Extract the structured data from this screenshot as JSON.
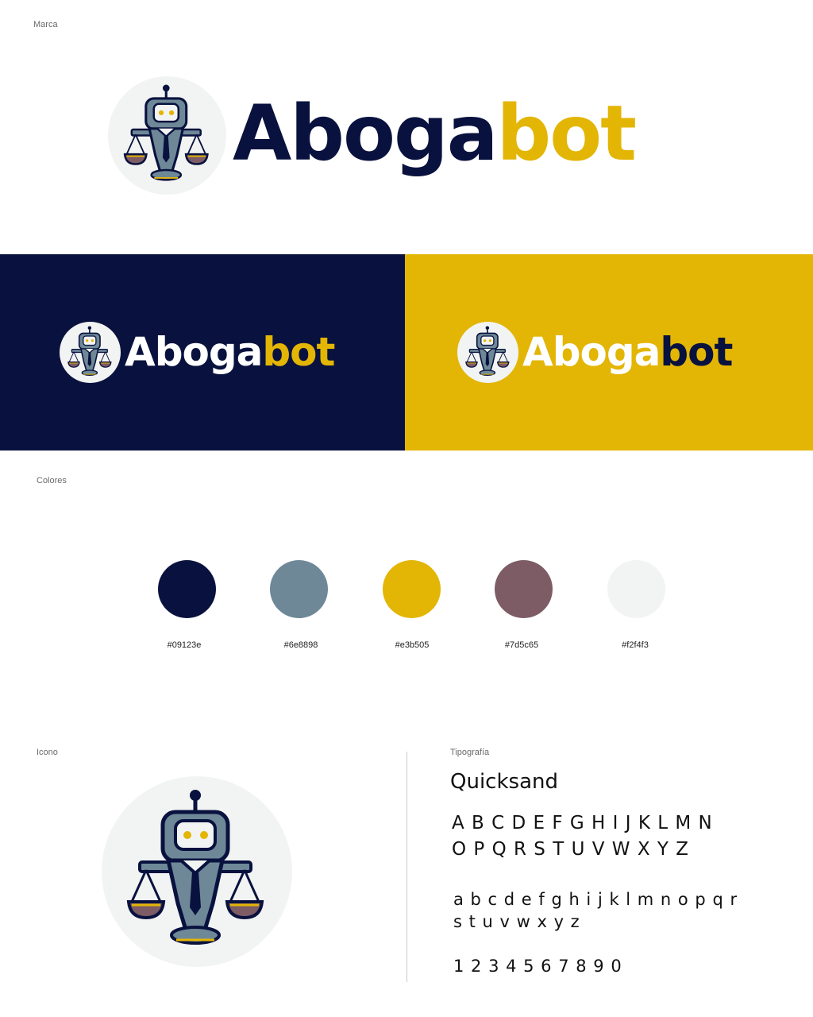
{
  "sections": {
    "brand_label": "Marca",
    "colors_label": "Colores",
    "icon_label": "Icono",
    "typography_label": "Tipografía"
  },
  "brand": {
    "name_part1": "Aboga",
    "name_part2": "bot"
  },
  "palette": [
    {
      "hex": "#09123e"
    },
    {
      "hex": "#6e8898"
    },
    {
      "hex": "#e3b505"
    },
    {
      "hex": "#7d5c65"
    },
    {
      "hex": "#f2f4f3"
    }
  ],
  "typography": {
    "font_name": "Quicksand",
    "uppercase_line1": "A B C D E F G H I J K L M N",
    "uppercase_line2": "O P Q R S T U V W X Y Z",
    "lowercase_line1": "a b c d e f g h i j k  l m n o p q r",
    "lowercase_line2": "s t u v w x y z",
    "numbers": "1 2 3 4 5 6 7 8 9 0"
  },
  "icons": [
    "robot-lawyer-scales-icon"
  ]
}
